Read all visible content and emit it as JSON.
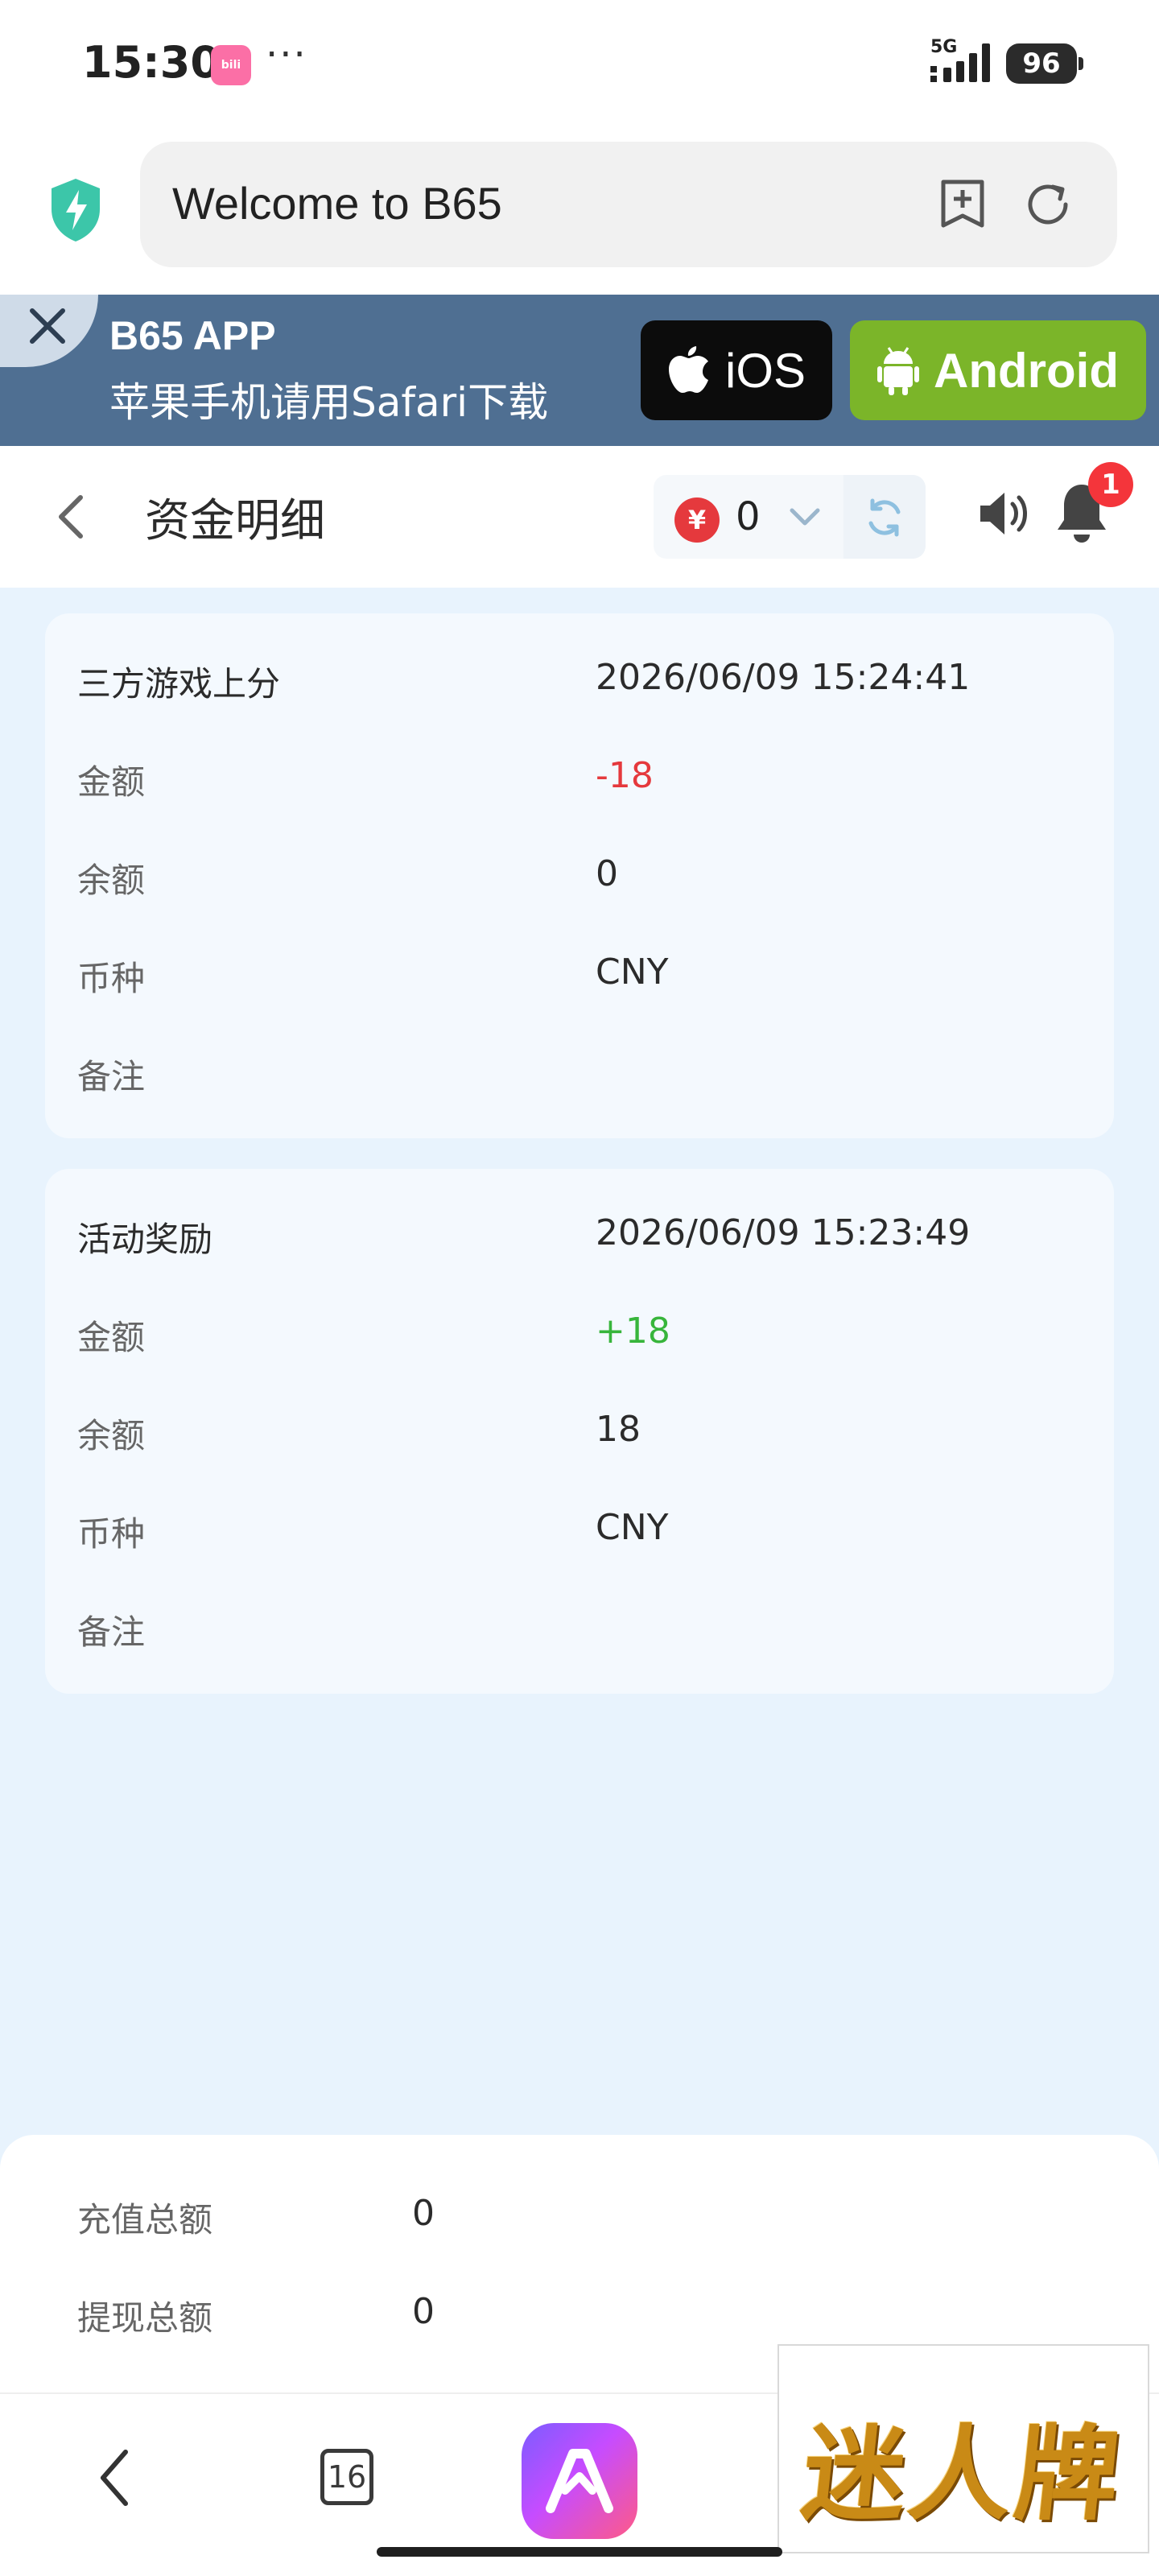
{
  "status_bar": {
    "time": "15:30",
    "app_icon_text": "bili",
    "more": "···",
    "network": "5G",
    "battery": "96"
  },
  "browser": {
    "url_title": "Welcome to B65"
  },
  "banner": {
    "title": "B65 APP",
    "subtitle": "苹果手机请用Safari下载",
    "ios_label": "iOS",
    "android_label": "Android"
  },
  "header": {
    "title": "资金明细",
    "currency_symbol": "¥",
    "balance": "0",
    "notification_count": "1"
  },
  "records": [
    {
      "type": "三方游戏上分",
      "time": "2026/06/09 15:24:41",
      "amount_label": "金额",
      "amount": "-18",
      "balance_label": "余额",
      "balance": "0",
      "currency_label": "币种",
      "currency": "CNY",
      "note_label": "备注",
      "note": ""
    },
    {
      "type": "活动奖励",
      "time": "2026/06/09 15:23:49",
      "amount_label": "金额",
      "amount": "+18",
      "balance_label": "余额",
      "balance": "18",
      "currency_label": "币种",
      "currency": "CNY",
      "note_label": "备注",
      "note": ""
    }
  ],
  "summary": {
    "deposit_label": "充值总额",
    "deposit_value": "0",
    "withdraw_label": "提现总额",
    "withdraw_value": "0"
  },
  "toolbar": {
    "tab_count": "16"
  },
  "watermark": {
    "text": "迷人牌"
  },
  "colors": {
    "negative": "#e5393d",
    "positive": "#37b53b",
    "banner_bg": "#4f6f92",
    "android_green": "#7bb529"
  }
}
